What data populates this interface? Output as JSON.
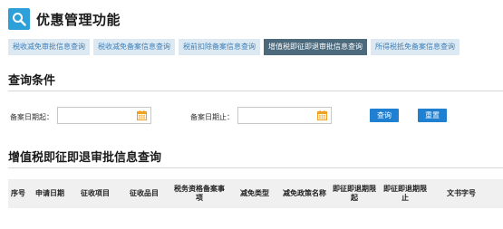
{
  "header": {
    "title": "优惠管理功能"
  },
  "tabs": [
    {
      "label": "税收减免审批信息查询",
      "active": false
    },
    {
      "label": "税收减免备案信息查询",
      "active": false
    },
    {
      "label": "税前扣除备案信息查询",
      "active": false
    },
    {
      "label": "增值税即征即退审批信息查询",
      "active": true
    },
    {
      "label": "所得税抵免备案信息查询",
      "active": false
    }
  ],
  "query": {
    "section_title": "查询条件",
    "start_label": "备案日期起：",
    "end_label": "备案日期止：",
    "start_value": "",
    "end_value": "",
    "query_button": "查询",
    "reset_button": "重置"
  },
  "results": {
    "section_title": "增值税即征即退审批信息查询",
    "columns": [
      "序号",
      "申请日期",
      "征收项目",
      "征收品目",
      "税务资格备案事项",
      "减免类型",
      "减免政策名称",
      "即征即退期限起",
      "即征即退期限止",
      "文书字号"
    ]
  },
  "colors": {
    "accent": "#2d9fd9",
    "active_tab": "#4d6a7d",
    "tab_bg": "#dde9f2",
    "button": "#1f7fd0",
    "calendar": "#f0a020"
  },
  "icons": {
    "logo": "search-icon",
    "date": "calendar-icon"
  }
}
